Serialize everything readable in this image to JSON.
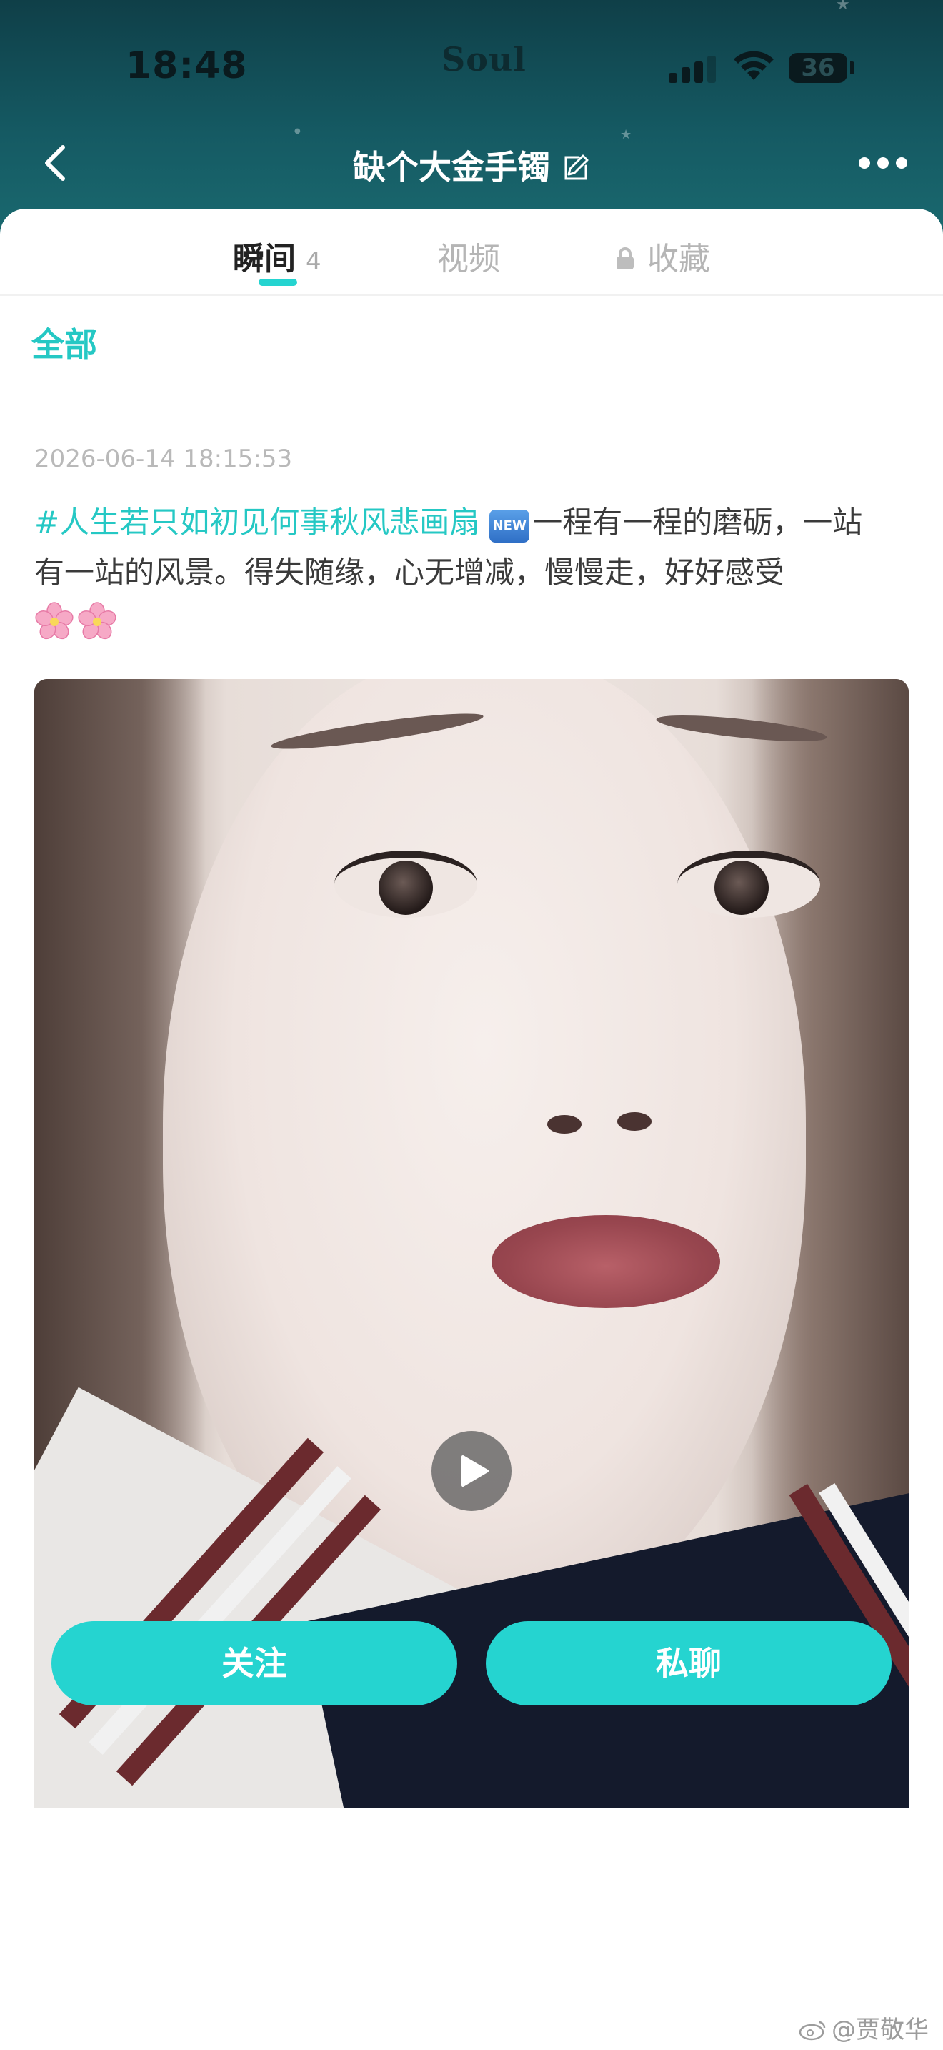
{
  "status_bar": {
    "time": "18:48",
    "app_brand": "Soul",
    "battery": "36"
  },
  "nav": {
    "title": "缺个大金手镯"
  },
  "tabs": [
    {
      "label": "瞬间",
      "count": "4"
    },
    {
      "label": "视频"
    },
    {
      "label": "收藏"
    }
  ],
  "filter": {
    "label": "全部"
  },
  "post": {
    "timestamp": "2026-06-14 18:15:53",
    "hashtag": "#人生若只如初见何事秋风悲画扇",
    "new_badge": "NEW",
    "text": "一程有一程的磨砺，一站有一站的风景。得失随缘，心无增减，慢慢走，好好感受"
  },
  "actions": {
    "follow_label": "关注",
    "chat_label": "私聊"
  },
  "watermark": {
    "text": "@贾敬华"
  },
  "colors": {
    "accent": "#25d4d0",
    "header_bg": "#155a63",
    "hashtag": "#25c8c4"
  }
}
